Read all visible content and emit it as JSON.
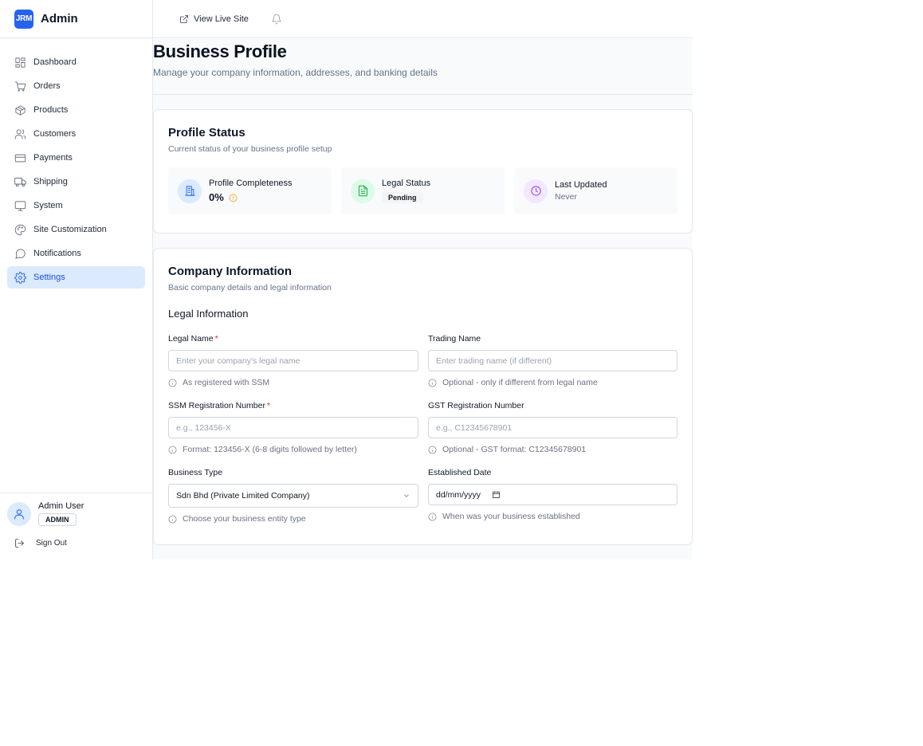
{
  "brand": {
    "logo_text": "JRM",
    "title": "Admin",
    "logo_color": "#2563eb"
  },
  "sidebar": {
    "items": [
      {
        "label": "Dashboard",
        "icon": "dashboard-icon"
      },
      {
        "label": "Orders",
        "icon": "cart-icon"
      },
      {
        "label": "Products",
        "icon": "box-icon"
      },
      {
        "label": "Customers",
        "icon": "users-icon"
      },
      {
        "label": "Payments",
        "icon": "credit-card-icon"
      },
      {
        "label": "Shipping",
        "icon": "truck-icon"
      },
      {
        "label": "System",
        "icon": "monitor-icon"
      },
      {
        "label": "Site Customization",
        "icon": "palette-icon"
      },
      {
        "label": "Notifications",
        "icon": "message-circle-icon"
      },
      {
        "label": "Settings",
        "icon": "gear-icon",
        "active": true
      }
    ],
    "active_color": "#dbeafe"
  },
  "user": {
    "name": "Admin User",
    "role": "ADMIN",
    "sign_out": "Sign Out"
  },
  "topbar": {
    "view_live_site": "View Live Site",
    "bell_icon": "bell-icon"
  },
  "page": {
    "title": "Business Profile",
    "subtitle": "Manage your company information, addresses, and banking details"
  },
  "profile_status": {
    "title": "Profile Status",
    "subtitle": "Current status of your business profile setup",
    "stats": [
      {
        "label": "Profile Completeness",
        "value": "0%",
        "icon": "building-icon",
        "icon_bg": "#dbeafe",
        "icon_color": "#2563eb"
      },
      {
        "label": "Legal Status",
        "value": "Pending",
        "icon": "document-icon",
        "icon_bg": "#dcfce7",
        "icon_color": "#16a34a"
      },
      {
        "label": "Last Updated",
        "value": "Never",
        "icon": "clock-icon",
        "icon_bg": "#f3e8ff",
        "icon_color": "#9333ea"
      }
    ]
  },
  "company_info": {
    "title": "Company Information",
    "subtitle": "Basic company details and legal information",
    "section_title": "Legal Information",
    "fields": {
      "legal_name": {
        "label": "Legal Name",
        "required": "*",
        "placeholder": "Enter your company's legal name",
        "value": "",
        "hint": "As registered with SSM"
      },
      "trading_name": {
        "label": "Trading Name",
        "placeholder": "Enter trading name (if different)",
        "value": "",
        "hint": "Optional - only if different from legal name"
      },
      "ssm_number": {
        "label": "SSM Registration Number",
        "required": "*",
        "placeholder": "e.g., 123456-X",
        "value": "",
        "hint": "Format: 123456-X (6-8 digits followed by letter)"
      },
      "gst_number": {
        "label": "GST Registration Number",
        "placeholder": "e.g., C12345678901",
        "value": "",
        "hint": "Optional - GST format: C12345678901"
      },
      "business_type": {
        "label": "Business Type",
        "value": "Sdn Bhd (Private Limited Company)",
        "hint": "Choose your business entity type"
      },
      "established_date": {
        "label": "Established Date",
        "value": "dd/mm/yyyy",
        "hint": "When was your business established"
      }
    }
  }
}
